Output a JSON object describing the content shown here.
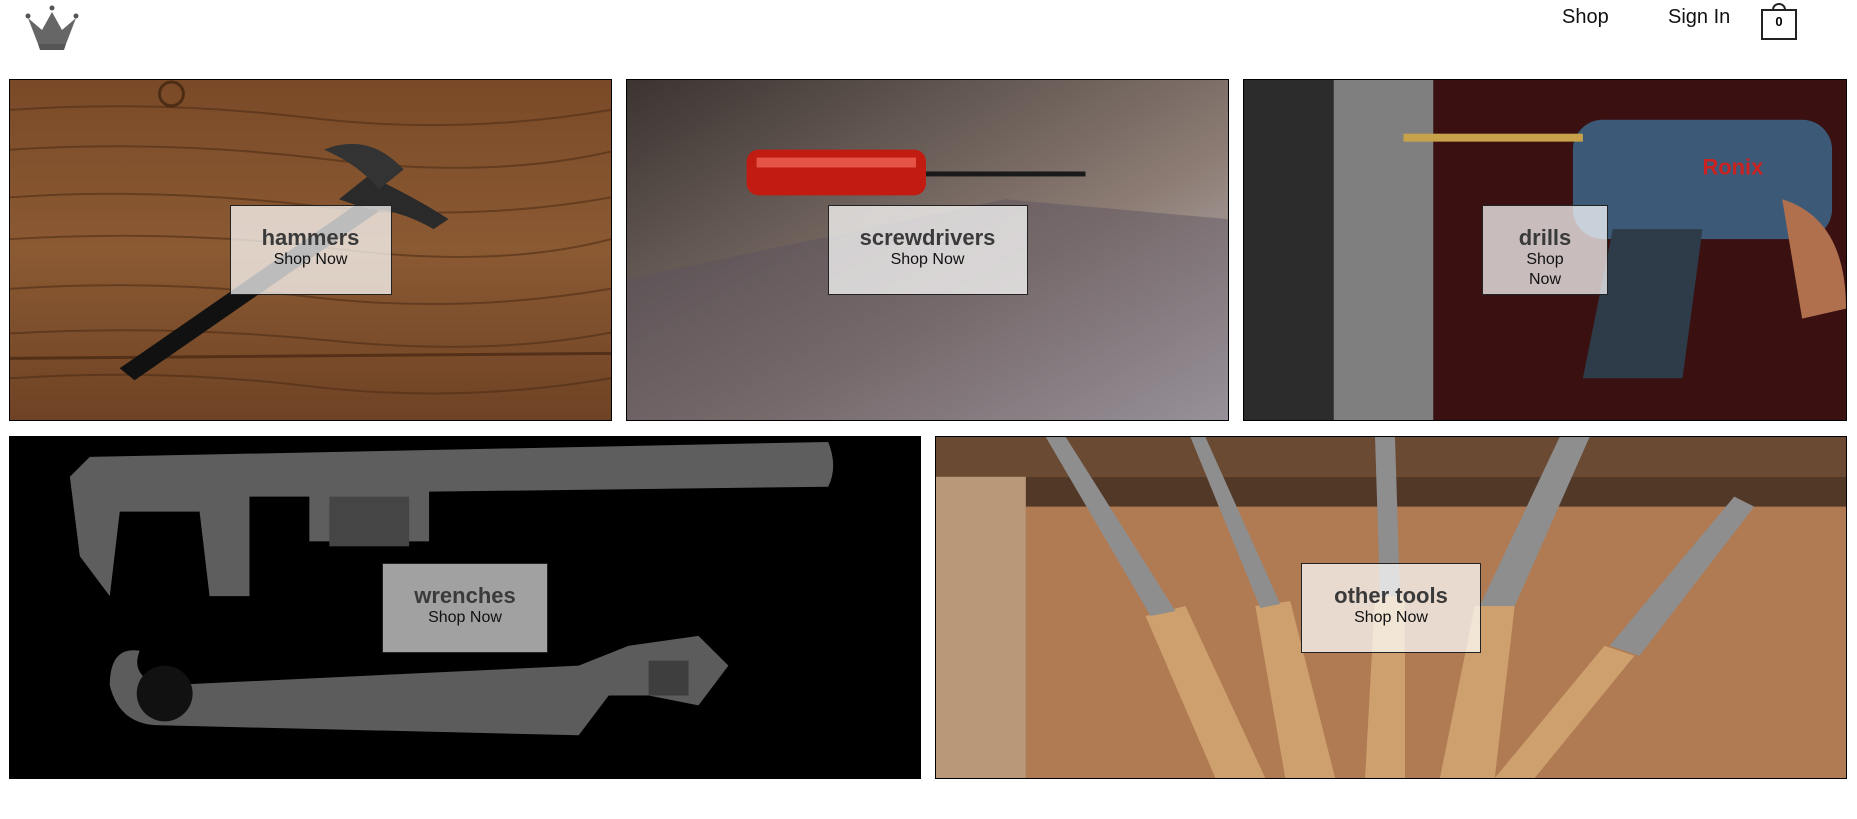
{
  "header": {
    "logo_icon": "crown-icon",
    "nav": {
      "shop_label": "Shop",
      "signin_label": "Sign In"
    },
    "cart": {
      "icon": "shopping-bag-icon",
      "count": "0"
    }
  },
  "categories": [
    {
      "title": "hammers",
      "cta": "Shop Now"
    },
    {
      "title": "screwdrivers",
      "cta": "Shop Now"
    },
    {
      "title": "drills",
      "cta": "Shop Now"
    },
    {
      "title": "wrenches",
      "cta": "Shop Now"
    },
    {
      "title": "other tools",
      "cta": "Shop Now"
    }
  ]
}
